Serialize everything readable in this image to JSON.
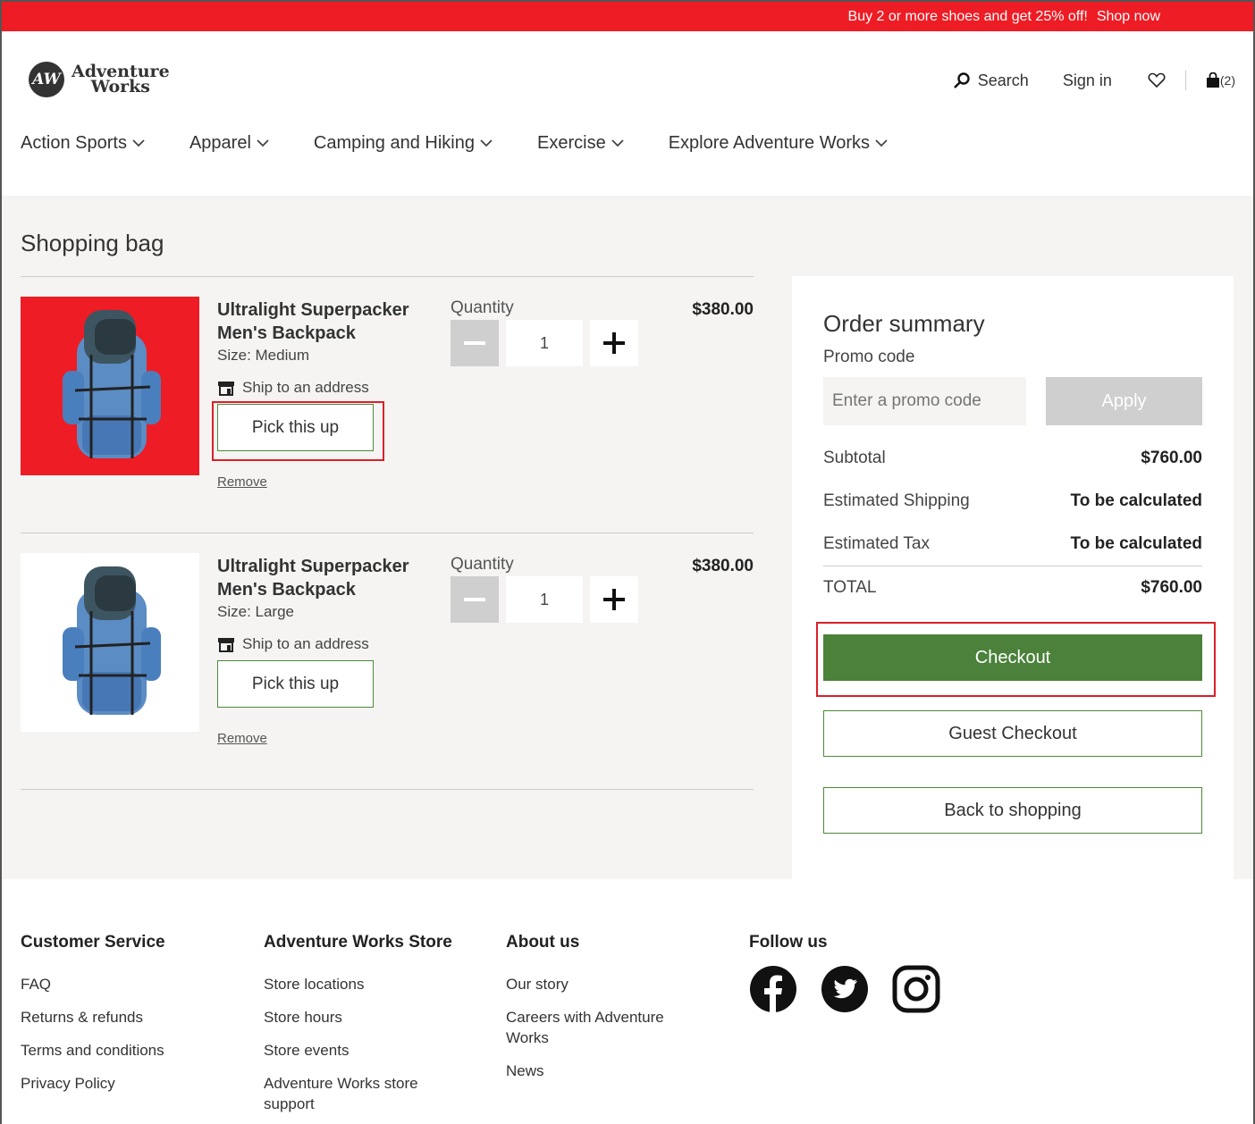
{
  "promo_bar": {
    "text": "Buy 2 or more shoes and get 25% off!",
    "link": "Shop now"
  },
  "brand": {
    "logo_mark": "AW",
    "name_line1": "Adventure",
    "name_line2": "Works"
  },
  "utility": {
    "search_label": "Search",
    "signin_label": "Sign in",
    "cart_count": "(2)"
  },
  "nav": [
    {
      "label": "Action Sports"
    },
    {
      "label": "Apparel"
    },
    {
      "label": "Camping and Hiking"
    },
    {
      "label": "Exercise"
    },
    {
      "label": "Explore Adventure Works"
    }
  ],
  "bag": {
    "title": "Shopping bag",
    "quantity_label": "Quantity",
    "ship_label": "Ship to an address",
    "pickup_label": "Pick this up",
    "remove_label": "Remove",
    "items": [
      {
        "name_line1": "Ultralight Superpacker",
        "name_line2": "Men's Backpack",
        "size": "Size: Medium",
        "quantity": "1",
        "price": "$380.00",
        "image_bg": "#ee1c24"
      },
      {
        "name_line1": "Ultralight Superpacker",
        "name_line2": "Men's Backpack",
        "size": "Size: Large",
        "quantity": "1",
        "price": "$380.00",
        "image_bg": "#ffffff"
      }
    ]
  },
  "summary": {
    "title": "Order summary",
    "promo_label": "Promo code",
    "promo_placeholder": "Enter a promo code",
    "apply_label": "Apply",
    "subtotal_label": "Subtotal",
    "subtotal_value": "$760.00",
    "shipping_label": "Estimated Shipping",
    "shipping_value": "To be calculated",
    "tax_label": "Estimated Tax",
    "tax_value": "To be calculated",
    "total_label": "TOTAL",
    "total_value": "$760.00",
    "checkout_label": "Checkout",
    "guest_label": "Guest Checkout",
    "back_label": "Back to shopping"
  },
  "footer": {
    "customer_service": {
      "title": "Customer Service",
      "links": [
        "FAQ",
        "Returns & refunds",
        "Terms and conditions",
        "Privacy Policy"
      ]
    },
    "store": {
      "title": "Adventure Works Store",
      "links": [
        "Store locations",
        "Store hours",
        "Store events",
        "Adventure Works store support"
      ]
    },
    "about": {
      "title": "About us",
      "links": [
        "Our story",
        "Careers with Adventure Works",
        "News"
      ]
    },
    "follow": {
      "title": "Follow us",
      "icons": [
        "facebook-icon",
        "twitter-icon",
        "instagram-icon"
      ]
    }
  },
  "colors": {
    "promo_red": "#ee1c24",
    "checkout_green": "#4b813a",
    "highlight_red": "#d9202a"
  }
}
